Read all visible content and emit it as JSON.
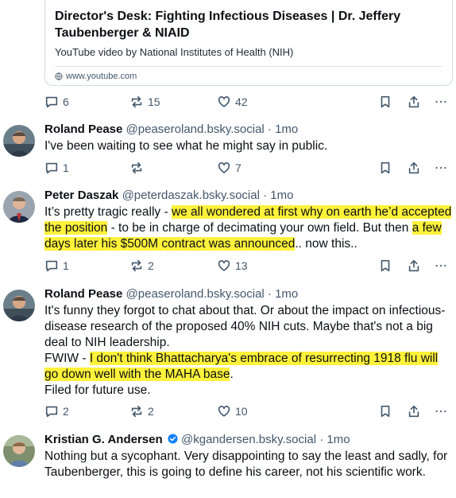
{
  "card": {
    "title": "Director's Desk: Fighting Infectious Diseases | Dr. Jeffery Taubenberger & NIAID",
    "description": "YouTube video by National Institutes of Health (NIH)",
    "url": "www.youtube.com"
  },
  "card_actions": {
    "replies": "6",
    "reposts": "15",
    "likes": "42"
  },
  "posts": [
    {
      "author": "Roland Pease",
      "handle": "@peaseroland.bsky.social · 1mo",
      "text": "I've been waiting to see what he might say in public.",
      "replies": "1",
      "reposts": "",
      "likes": "7"
    },
    {
      "author": "Peter Daszak",
      "handle": "@peterdaszak.bsky.social · 1mo",
      "text_parts": [
        "It’s pretty tragic really - ",
        "we all wondered at first why on earth he’d accepted the position",
        " - to be in charge of decimating your own field. But then ",
        "a few days later his $500M contract was announced",
        ".. now this.."
      ],
      "replies": "1",
      "reposts": "2",
      "likes": "13"
    },
    {
      "author": "Roland Pease",
      "handle": "@peaseroland.bsky.social · 1mo",
      "text_parts": [
        "It's funny they forgot to chat about that. Or about the impact on infectious-disease research of the proposed 40% NIH cuts. Maybe that's not a big deal to NIH leadership.",
        "FWIW - ",
        " I don't think Bhattacharya's embrace of resurrecting 1918 flu will go down well with the MAHA base",
        ".",
        "Filed for future use."
      ],
      "replies": "2",
      "reposts": "2",
      "likes": "10"
    },
    {
      "author": "Kristian G. Andersen",
      "handle": "@kgandersen.bsky.social · 1mo",
      "text": "Nothing but a sycophant. Very disappointing to say the least and sadly, for Taubenberger, this is going to define his career, not his scientific work."
    }
  ],
  "icons": [
    "reply-icon",
    "repost-icon",
    "like-icon",
    "bookmark-icon",
    "share-icon",
    "more-icon",
    "globe-icon",
    "verified-icon"
  ],
  "colors": {
    "highlight": "#fff23b",
    "muted": "#42576c",
    "verified": "#1083fe"
  }
}
